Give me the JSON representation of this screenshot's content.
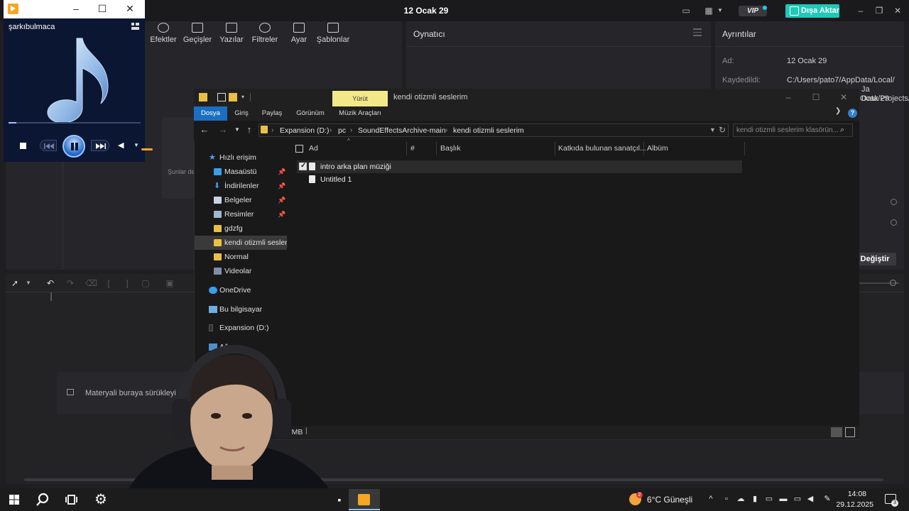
{
  "editor": {
    "title": "12 Ocak 29",
    "vip_label": "VIP",
    "export_label": "Dışa Aktar",
    "media_tabs": [
      {
        "label": "Efektler"
      },
      {
        "label": "Geçişler"
      },
      {
        "label": "Yazılar"
      },
      {
        "label": "Filtreler"
      },
      {
        "label": "Ayar"
      },
      {
        "label": "Şablonlar"
      }
    ],
    "media_hint": "Şunlar de",
    "player_title": "Oynatıcı",
    "details": {
      "title": "Ayrıntılar",
      "name_label": "Ad:",
      "name_value": "12 Ocak 29",
      "saved_label": "Kaydedildi:",
      "saved_value_line1": "C:/Users/pato7/AppData/Local/",
      "saved_value_line2": "Ja Data/Projects/",
      "saved_value_line3": "Ocak 29",
      "change_button": "Değiştir"
    },
    "timeline_drop_text": "Materyali buraya sürükleyi"
  },
  "mini_player": {
    "song_title": "şarkıbulmaca",
    "progress_fraction": 0.06
  },
  "explorer": {
    "context_tab": "Yürüt",
    "window_title": "kendi otizmli seslerim",
    "ribbon_tabs": [
      "Dosya",
      "Giriş",
      "Paylaş",
      "Görünüm",
      "Müzik Araçları"
    ],
    "breadcrumbs": [
      "Expansion (D:)",
      "pc",
      "SoundEffectsArchive-main",
      "kendi otizmli seslerim"
    ],
    "search_placeholder": "kendi otizmli seslerim klasörün...",
    "nav": {
      "quick_access": "Hızlı erişim",
      "items": [
        {
          "label": "Masaüstü",
          "pinned": true
        },
        {
          "label": "İndirilenler",
          "pinned": true
        },
        {
          "label": "Belgeler",
          "pinned": true
        },
        {
          "label": "Resimler",
          "pinned": true
        },
        {
          "label": "gdzfg",
          "pinned": false
        },
        {
          "label": "kendi otizmli sesleri",
          "pinned": false
        },
        {
          "label": "Normal",
          "pinned": false
        },
        {
          "label": "Videolar",
          "pinned": false
        }
      ],
      "onedrive": "OneDrive",
      "this_pc": "Bu bilgisayar",
      "drive": "Expansion (D:)",
      "network": "Ağ"
    },
    "columns": [
      "Ad",
      "#",
      "Başlık",
      "Katkıda bulunan sanatçıl...",
      "Albüm"
    ],
    "files": [
      {
        "name": "intro arka plan müziği",
        "checked": true
      },
      {
        "name": "Untitled 1",
        "checked": false
      }
    ],
    "status_size": "01 MB"
  },
  "taskbar": {
    "weather_temp": "6°C",
    "weather_desc": "Güneşli",
    "weather_badge": "2",
    "time": "14:08",
    "date": "29.12.2025",
    "notif_count": "3"
  },
  "colors": {
    "accent_export": "#1fc8b8",
    "explorer_file_tab": "#1a6fc2",
    "context_tab": "#f3e889",
    "folder_yellow": "#e9c046",
    "player_bg": "#0b1633"
  }
}
